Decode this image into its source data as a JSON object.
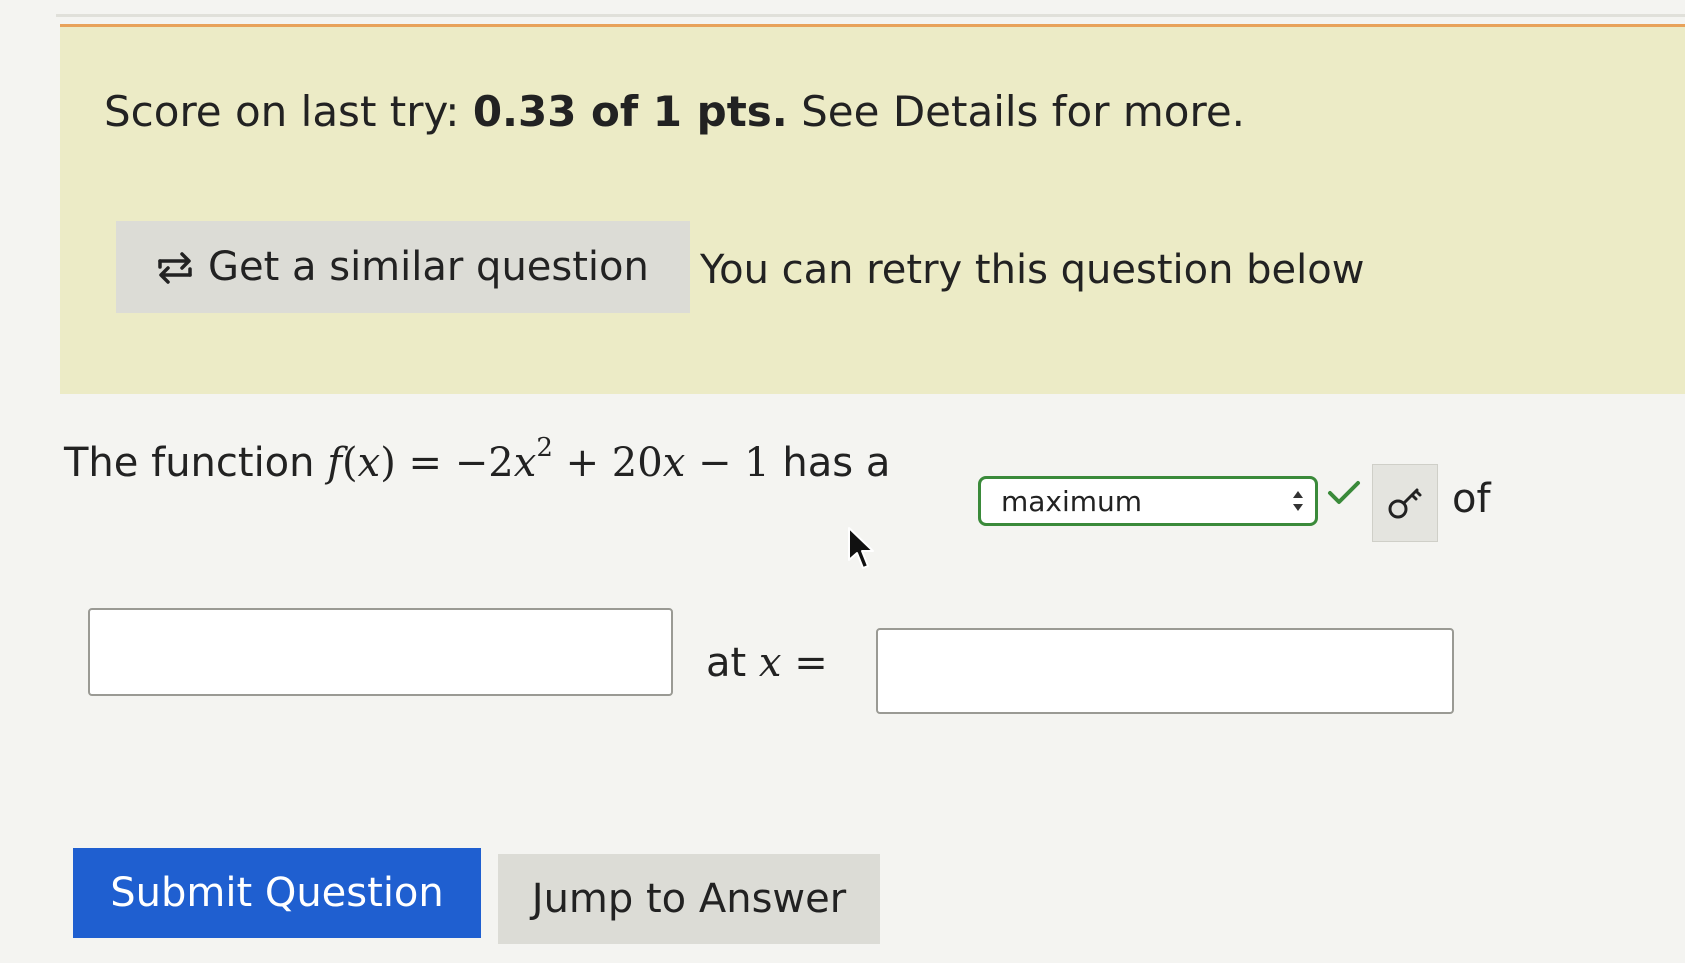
{
  "feedback": {
    "score_prefix": "Score on last try:",
    "score_value": "0.33 of 1 pts.",
    "score_suffix": "See Details for more.",
    "similar_button_label": "Get a similar question",
    "retry_text": "You can retry this question below",
    "accent_color": "#e8a25a",
    "background_color": "#ecebc6"
  },
  "question": {
    "prefix": "The function",
    "f_name": "f",
    "var": "x",
    "eq_part1": "= −2",
    "exponent": "2",
    "eq_part2": "+ 20",
    "eq_part3": "− 1",
    "has_a": "has a",
    "dropdown_selected": "maximum",
    "of_text": "of",
    "at_text": "at",
    "equals": "=",
    "correct_color": "#3a8a3a"
  },
  "answers": {
    "value_placeholder": "",
    "x_placeholder": ""
  },
  "buttons": {
    "submit_label": "Submit Question",
    "submit_color": "#1f5fd0",
    "jump_label": "Jump to Answer"
  },
  "icons": {
    "similar": "retry-arrows-icon",
    "check": "checkmark-icon",
    "hint": "key-icon",
    "cursor": "mouse-pointer-icon"
  }
}
